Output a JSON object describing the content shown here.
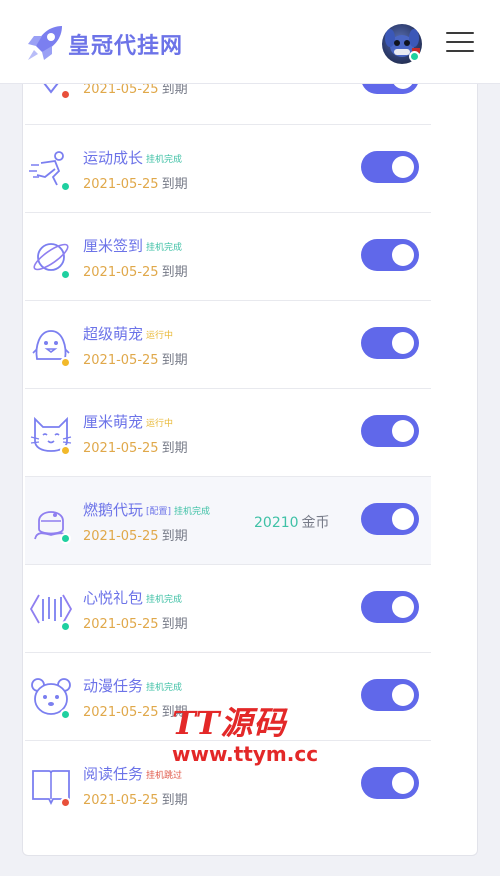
{
  "header": {
    "brand": "皇冠代挂网",
    "icons": {
      "logo": "rocket-icon",
      "avatar": "user-avatar",
      "menu": "hamburger-menu-icon"
    }
  },
  "colors": {
    "accent": "#6068ea",
    "brand_text": "#6c73e8",
    "date": "#e0a84a",
    "done": "#3fc1a6",
    "running": "#e8b836",
    "skipped": "#e05a4a",
    "dot_green": "#1fd0a0",
    "dot_yellow": "#f2b92a",
    "dot_red": "#e8503a"
  },
  "top_partial": {
    "date": "2021-05-25",
    "expire": "到期",
    "icon": "diamond-icon",
    "enabled": true
  },
  "tasks": [
    {
      "name": "运动成长",
      "tag": "挂机完成",
      "date": "2021-05-25",
      "expire": "到期",
      "icon": "running-person-icon",
      "enabled": true
    },
    {
      "name": "厘米签到",
      "tag": "挂机完成",
      "date": "2021-05-25",
      "expire": "到期",
      "icon": "planet-icon",
      "enabled": true
    },
    {
      "name": "超级萌宠",
      "tag": "运行中",
      "date": "2021-05-25",
      "expire": "到期",
      "icon": "penguin-icon",
      "enabled": true
    },
    {
      "name": "厘米萌宠",
      "tag": "运行中",
      "date": "2021-05-25",
      "expire": "到期",
      "icon": "cat-icon",
      "enabled": true
    },
    {
      "name": "燃鹅代玩",
      "config": "[配置]",
      "tag": "挂机完成",
      "coins": "20210",
      "coins_unit": "金币",
      "date": "2021-05-25",
      "expire": "到期",
      "icon": "astronaut-icon",
      "enabled": true
    },
    {
      "name": "心悦礼包",
      "tag": "挂机完成",
      "date": "2021-05-25",
      "expire": "到期",
      "icon": "gift-arrows-icon",
      "enabled": true
    },
    {
      "name": "动漫任务",
      "tag": "挂机完成",
      "date": "2021-05-25",
      "expire": "到期",
      "icon": "bear-icon",
      "enabled": true
    },
    {
      "name": "阅读任务",
      "tag": "挂机跳过",
      "date": "2021-05-25",
      "expire": "到期",
      "icon": "book-icon",
      "enabled": true
    }
  ],
  "watermark": {
    "line1": "TT源码",
    "line2": "www.ttym.cc"
  }
}
